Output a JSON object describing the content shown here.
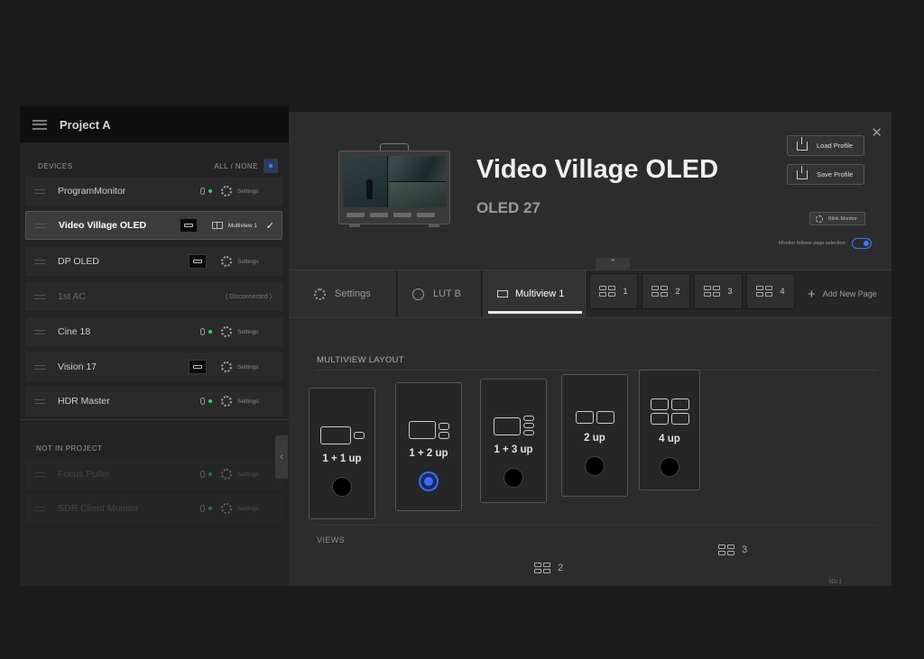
{
  "project": {
    "title": "Project A",
    "menu_icon": "hamburger-icon"
  },
  "devices_header": {
    "label": "DEVICES",
    "all_none": "ALL / NONE"
  },
  "devices": [
    {
      "name": "ProgramMonitor",
      "indicator": "signal",
      "action": "Settings"
    },
    {
      "name": "Video Village OLED",
      "indicator": "hdmi",
      "action": "Multiview 1",
      "selected": true
    },
    {
      "name": "DP OLED",
      "indicator": "hdmi",
      "action": "Settings"
    },
    {
      "name": "1st AC",
      "indicator": "none",
      "action": "( Disconnected )",
      "disconnected": true
    },
    {
      "name": "Cine 18",
      "indicator": "signal",
      "action": "Settings"
    },
    {
      "name": "Vision 17",
      "indicator": "hdmi",
      "action": "Settings"
    },
    {
      "name": "HDR Master",
      "indicator": "signal",
      "action": "Settings"
    }
  ],
  "not_in_project": {
    "label": "NOT IN PROJECT",
    "devices": [
      {
        "name": "Focus Puller",
        "action": "Settings"
      },
      {
        "name": "SDR Client Monitor",
        "action": "Settings"
      }
    ]
  },
  "detail": {
    "title": "Video Village OLED",
    "model": "OLED 27",
    "load_profile": "Load Profile",
    "save_profile": "Save Profile",
    "blink_monitor": "Blink Monitor",
    "follow_label": "Monitor follows page selection",
    "follow_on": true
  },
  "tabs": {
    "settings": "Settings",
    "lut": "LUT B",
    "multiview": "Multiview 1",
    "pages": [
      "1",
      "2",
      "3",
      "4"
    ],
    "add_page": "Add New Page"
  },
  "layout": {
    "section_label": "MULTIVIEW LAYOUT",
    "options": [
      "1 + 1 up",
      "1 + 2 up",
      "1 + 3 up",
      "2 up",
      "4 up"
    ],
    "selected": "1 + 2 up"
  },
  "views": {
    "section_label": "VIEWS",
    "indicators": [
      "2",
      "3"
    ],
    "sdi_label": "SDI 1"
  },
  "colors": {
    "accent": "#3a6dff",
    "signal_green": "#3ad36b"
  }
}
